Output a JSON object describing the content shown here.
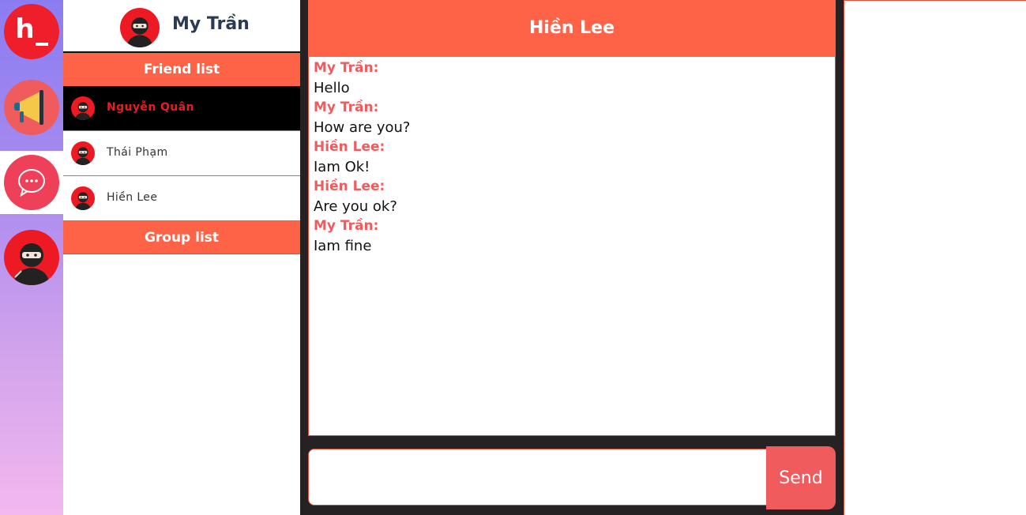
{
  "rail": {
    "logo_text": "h",
    "items": [
      "logo",
      "announcements",
      "messages",
      "profile"
    ],
    "active": "messages"
  },
  "user": {
    "name": "My Trần"
  },
  "friends": {
    "title": "Friend list",
    "items": [
      {
        "name": "Nguyễn Quân",
        "active": true
      },
      {
        "name": "Thái Phạm",
        "active": false
      },
      {
        "name": "Hiền Lee",
        "active": false
      }
    ]
  },
  "groups": {
    "title": "Group list"
  },
  "chat": {
    "title": "Hiền Lee",
    "messages": [
      {
        "sender": "My Trần:",
        "text": "Hello"
      },
      {
        "sender": "My Trần:",
        "text": "How are you?"
      },
      {
        "sender": "Hiền Lee:",
        "text": "Iam Ok!"
      },
      {
        "sender": "Hiền Lee:",
        "text": "Are you ok?"
      },
      {
        "sender": "My Trần:",
        "text": "Iam fine"
      }
    ],
    "input_value": "",
    "send_label": "Send"
  },
  "colors": {
    "accent": "#ff6347",
    "sender": "#f05b5d",
    "active_friend_text": "#e81c24",
    "chat_bg": "#262224"
  }
}
